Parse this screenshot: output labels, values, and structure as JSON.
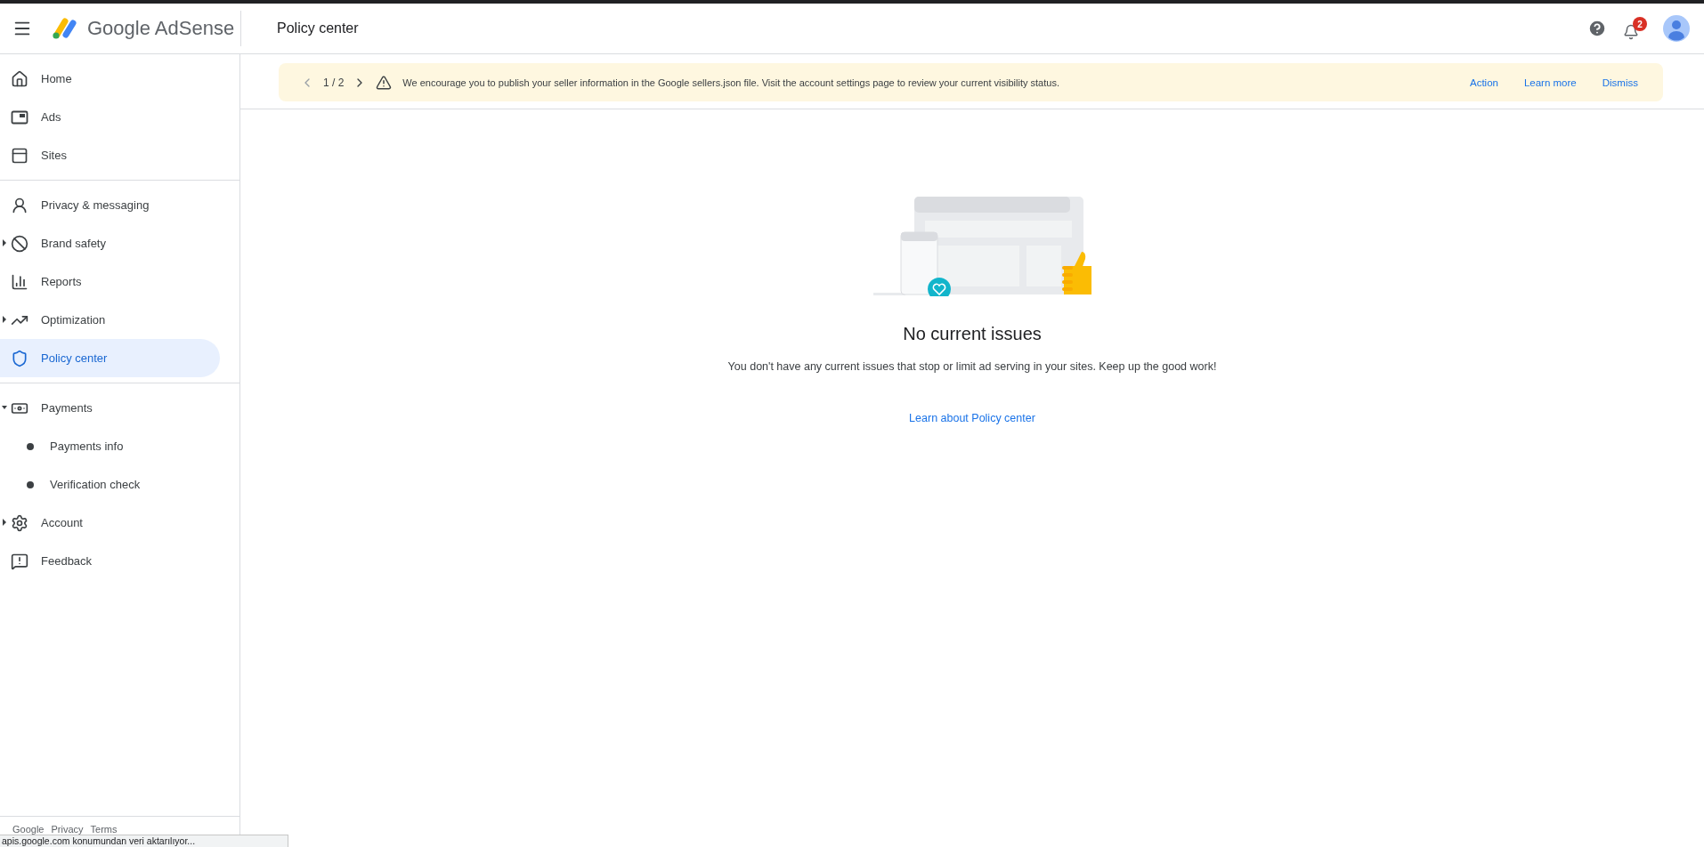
{
  "header": {
    "product": "Google AdSense",
    "page_title": "Policy center",
    "notifications_count": "2"
  },
  "sidebar": {
    "sections": [
      {
        "items": [
          {
            "label": "Home",
            "selected": false
          },
          {
            "label": "Ads",
            "selected": false
          },
          {
            "label": "Sites",
            "selected": false
          }
        ]
      },
      {
        "items": [
          {
            "label": "Privacy & messaging",
            "selected": false
          },
          {
            "label": "Brand safety",
            "selected": false,
            "expanded": false
          },
          {
            "label": "Reports",
            "selected": false
          },
          {
            "label": "Optimization",
            "selected": false,
            "expanded": false
          },
          {
            "label": "Policy center",
            "selected": true
          }
        ]
      },
      {
        "items": [
          {
            "label": "Payments",
            "selected": false,
            "expanded": true,
            "children": [
              {
                "label": "Payments info",
                "selected": false
              },
              {
                "label": "Verification check",
                "selected": false
              }
            ]
          },
          {
            "label": "Account",
            "selected": false,
            "expanded": false
          },
          {
            "label": "Feedback",
            "selected": false
          }
        ]
      }
    ],
    "footer_links": [
      "Google",
      "Privacy",
      "Terms"
    ]
  },
  "banner": {
    "pager": "1 / 2",
    "message": "We encourage you to publish your seller information in the Google sellers.json file. Visit the account settings page to review your current visibility status.",
    "actions": [
      "Action",
      "Learn more",
      "Dismiss"
    ]
  },
  "empty_state": {
    "title": "No current issues",
    "message": "You don't have any current issues that stop or limit ad serving in your sites. Keep up the good work!",
    "link": "Learn about Policy center"
  },
  "status_bar": {
    "text": "apis.google.com konumundan veri aktarılıyor..."
  }
}
